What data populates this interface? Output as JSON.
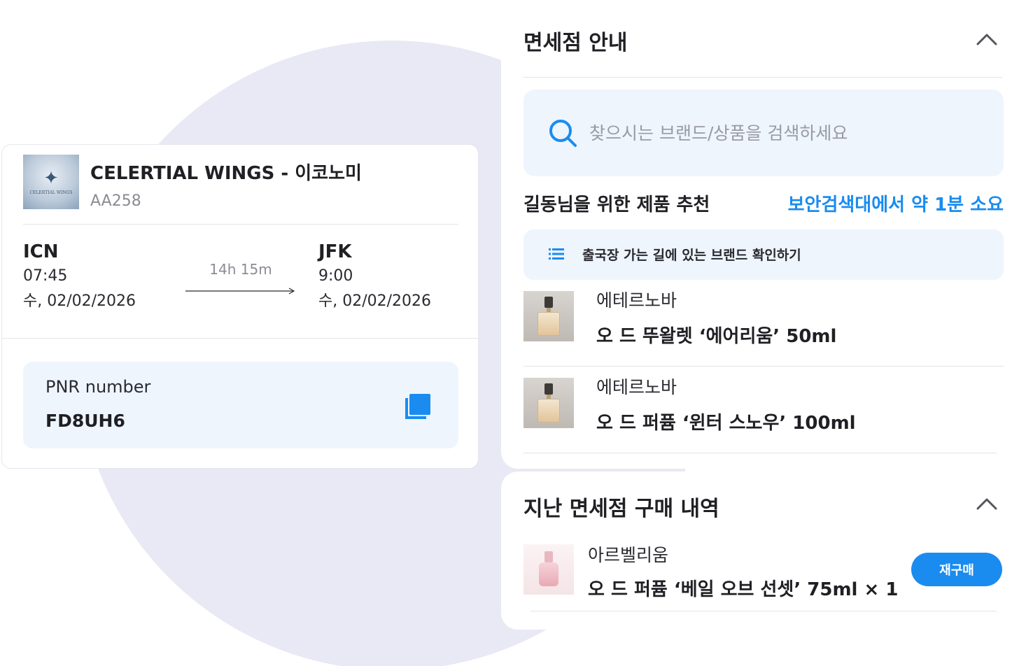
{
  "flight": {
    "airline_name": "CELERTIAL WINGS - 이코노미",
    "flight_number": "AA258",
    "logo_text": "CELERTIAL WINGS",
    "origin": {
      "code": "ICN",
      "time": "07:45",
      "date": "수, 02/02/2026"
    },
    "destination": {
      "code": "JFK",
      "time": "9:00",
      "date": "수, 02/02/2026"
    },
    "duration": "14h 15m",
    "pnr_label": "PNR number",
    "pnr_value": "FD8UH6"
  },
  "duty_free": {
    "title": "면세점 안내",
    "search_placeholder": "찾으시는 브랜드/상품을 검색하세요",
    "recommend_title": "길동님을 위한 제품 추천",
    "security_eta": "보안검색대에서 약 1분 소요",
    "brand_check_label": "출국장 가는 길에 있는 브랜드 확인하기",
    "products": [
      {
        "brand": "에테르노바",
        "name": "오 드 뚜왈렛 ‘에어리움’ 50ml"
      },
      {
        "brand": "에테르노바",
        "name": "오 드 퍼퓸 ‘윈터 스노우’ 100ml"
      }
    ]
  },
  "purchase_history": {
    "title": "지난 면세점 구매 내역",
    "items": [
      {
        "brand": "아르벨리움",
        "name": "오 드 퍼퓸 ‘베일 오브 선셋’ 75ml × 1",
        "rebuy_label": "재구매"
      }
    ]
  },
  "colors": {
    "accent": "#1a8cf0",
    "panel_tint": "#eef5fd",
    "background_circle": "#e9e8f5"
  },
  "icons": [
    "search-icon",
    "copy-icon",
    "chevron-up-icon",
    "list-icon",
    "arrow-right-icon"
  ]
}
